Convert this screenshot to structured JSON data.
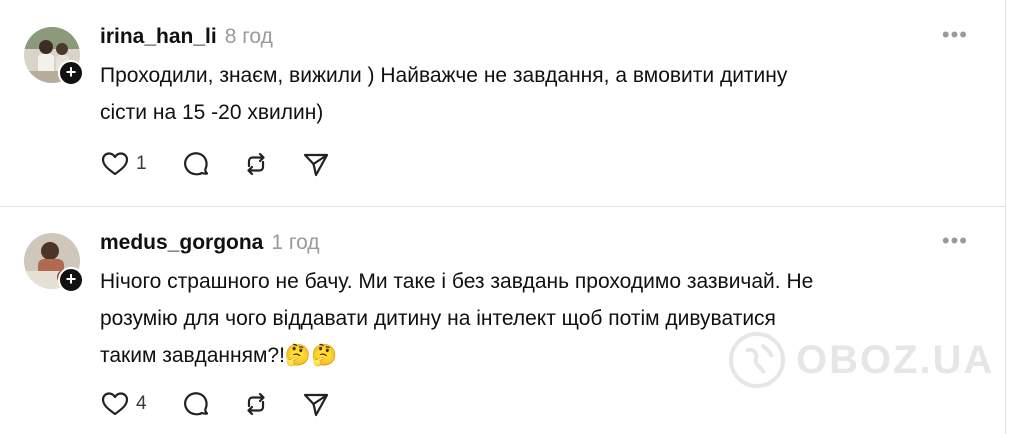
{
  "posts": [
    {
      "username": "irina_han_li",
      "time": "8 год",
      "text_line1": "Проходили, знаєм, вижили ) Найважче не завдання, а вмовити дитину",
      "text_line2": "сісти на 15 -20 хвилин)",
      "like_count": "1",
      "more": "•••",
      "follow": "+"
    },
    {
      "username": "medus_gorgona",
      "time": "1 год",
      "text_line1": "Нічого страшного не бачу. Ми таке і без завдань проходимо зазвичай. Не",
      "text_line2": "розумію для чого віддавати дитину на інтелект щоб потім дивуватися",
      "text_line3": "таким завданням?!🤔🤔",
      "like_count": "4",
      "more": "•••",
      "follow": "+"
    }
  ],
  "watermark": "OBOZ.UA",
  "icons": [
    "heart-icon",
    "comment-icon",
    "repost-icon",
    "share-icon",
    "more-icon"
  ]
}
